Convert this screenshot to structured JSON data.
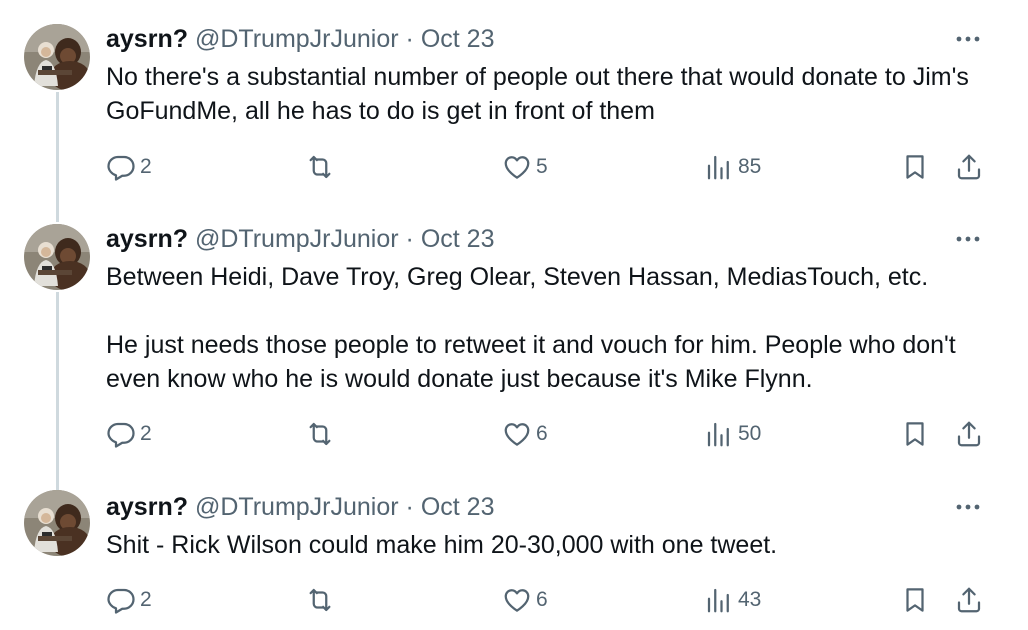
{
  "tweets": [
    {
      "display_name": "aysrn?",
      "handle": "@DTrumpJrJunior",
      "separator": "·",
      "date": "Oct 23",
      "paragraphs": [
        "No there's a substantial number of people out there that would donate to Jim's GoFundMe, all he has to do is get in front of them"
      ],
      "replies": "2",
      "reposts": "",
      "likes": "5",
      "views": "85"
    },
    {
      "display_name": "aysrn?",
      "handle": "@DTrumpJrJunior",
      "separator": "·",
      "date": "Oct 23",
      "paragraphs": [
        "Between Heidi, Dave Troy, Greg Olear, Steven Hassan, MediasTouch, etc.",
        "He just needs those people to retweet it and vouch for him. People who don't even know who he is would donate just because it's Mike Flynn."
      ],
      "replies": "2",
      "reposts": "",
      "likes": "6",
      "views": "50"
    },
    {
      "display_name": "aysrn?",
      "handle": "@DTrumpJrJunior",
      "separator": "·",
      "date": "Oct 23",
      "paragraphs": [
        "Shit - Rick Wilson could make him 20-30,000 with one tweet."
      ],
      "replies": "2",
      "reposts": "",
      "likes": "6",
      "views": "43"
    }
  ],
  "icons": {
    "more": "more-horizontal-icon",
    "reply": "reply-bubble-icon",
    "repost": "repost-arrows-icon",
    "like": "heart-icon",
    "views": "bar-chart-icon",
    "bookmark": "bookmark-icon",
    "share": "share-upload-icon"
  },
  "colors": {
    "text": "#0f1419",
    "secondary": "#536471",
    "thread_line": "#cfd9de",
    "background": "#ffffff"
  }
}
